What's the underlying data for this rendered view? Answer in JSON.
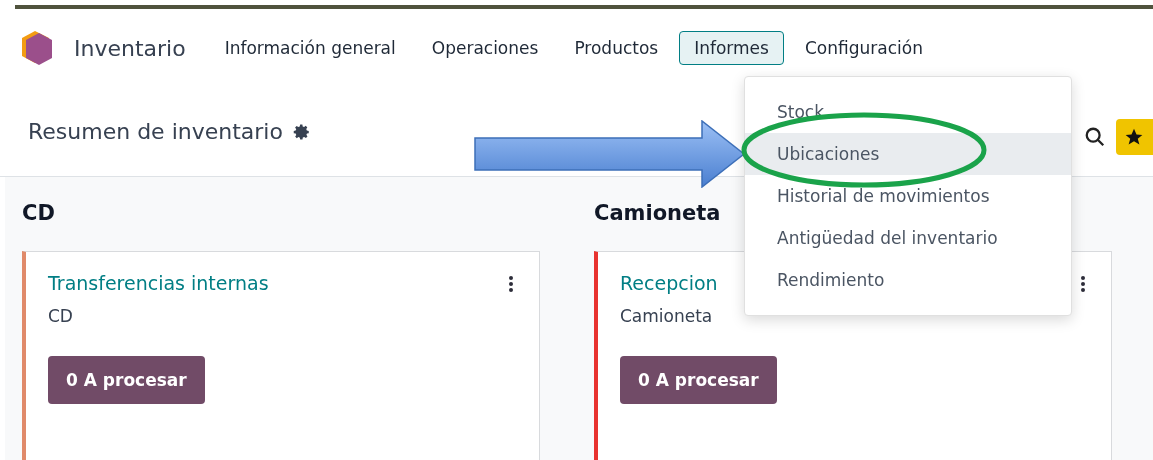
{
  "navbar": {
    "app_name": "Inventario",
    "menus": [
      {
        "label": "Información general",
        "selected": false
      },
      {
        "label": "Operaciones",
        "selected": false
      },
      {
        "label": "Productos",
        "selected": false
      },
      {
        "label": "Informes",
        "selected": true
      },
      {
        "label": "Configuración",
        "selected": false
      }
    ]
  },
  "dropdown": {
    "items": [
      {
        "label": "Stock",
        "selected": false
      },
      {
        "label": "Ubicaciones",
        "selected": true
      },
      {
        "label": "Historial de movimientos",
        "selected": false
      },
      {
        "label": "Antigüedad del inventario",
        "selected": false
      },
      {
        "label": "Rendimiento",
        "selected": false
      }
    ]
  },
  "control_panel": {
    "title": "Resumen de inventario"
  },
  "warehouses": [
    {
      "name": "CD",
      "card": {
        "title": "Transferencias internas",
        "subtitle": "CD",
        "button": "0 A procesar",
        "color": "#e08a6a"
      }
    },
    {
      "name": "Camioneta",
      "card": {
        "title": "Recepcion",
        "subtitle": "Camioneta",
        "button": "0 A procesar",
        "color": "#e8332f"
      }
    }
  ]
}
